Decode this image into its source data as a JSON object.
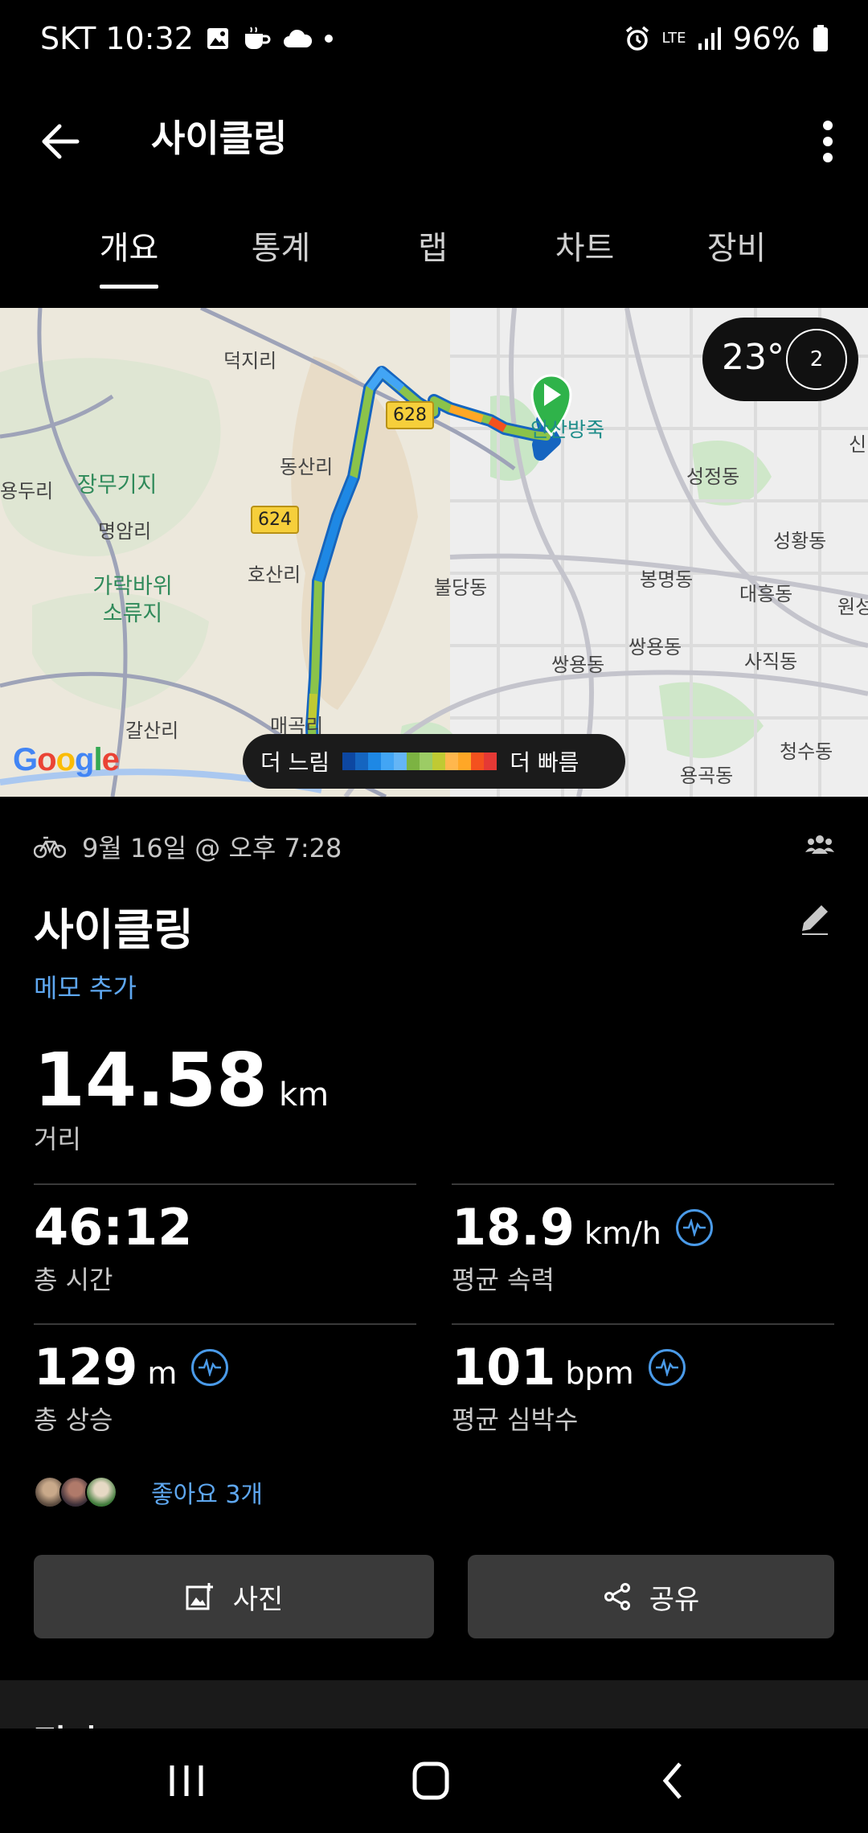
{
  "status": {
    "carrier_time": "SKT 10:32",
    "network": "LTE",
    "battery": "96%"
  },
  "appbar": {
    "title": "사이클링"
  },
  "tabs": [
    {
      "label": "개요",
      "active": true
    },
    {
      "label": "통계",
      "active": false
    },
    {
      "label": "랩",
      "active": false
    },
    {
      "label": "차트",
      "active": false
    },
    {
      "label": "장비",
      "active": false
    }
  ],
  "map": {
    "labels": [
      "덕지리",
      "동산리",
      "장무기지",
      "명암리",
      "가락바위 소류지",
      "호산리",
      "갈산리",
      "매곡리",
      "용두리",
      "안산방죽",
      "성정동",
      "성황동",
      "불당동",
      "봉명동",
      "대흥동",
      "원성",
      "쌍용동",
      "사직동",
      "청수동",
      "용곡동",
      "신"
    ],
    "route_badges": [
      "628",
      "624"
    ],
    "weather_temp": "23°",
    "uv_index": "2",
    "google": "Google",
    "legend_slow": "더 느림",
    "legend_fast": "더 빠름",
    "legend_colors": [
      "#0d47a1",
      "#1565c0",
      "#1e88e5",
      "#42a5f5",
      "#64b5f6",
      "#7cb342",
      "#9ccc65",
      "#c0ca33",
      "#ffb74d",
      "#ffa726",
      "#f4511e",
      "#e53935"
    ]
  },
  "activity": {
    "date": "9월 16일 @ 오후 7:28",
    "title": "사이클링",
    "memo_link": "메모 추가",
    "distance_value": "14.58",
    "distance_unit": "km",
    "distance_label": "거리"
  },
  "stats": [
    {
      "value": "46:12",
      "unit": "",
      "label": "총 시간",
      "badge": false
    },
    {
      "value": "18.9",
      "unit": "km/h",
      "label": "평균 속력",
      "badge": true
    },
    {
      "value": "129",
      "unit": "m",
      "label": "총 상승",
      "badge": true
    },
    {
      "value": "101",
      "unit": "bpm",
      "label": "평균 심박수",
      "badge": true
    }
  ],
  "likes": {
    "text": "좋아요 3개"
  },
  "buttons": {
    "photo": "사진",
    "share": "공유"
  },
  "next_section": "평가"
}
